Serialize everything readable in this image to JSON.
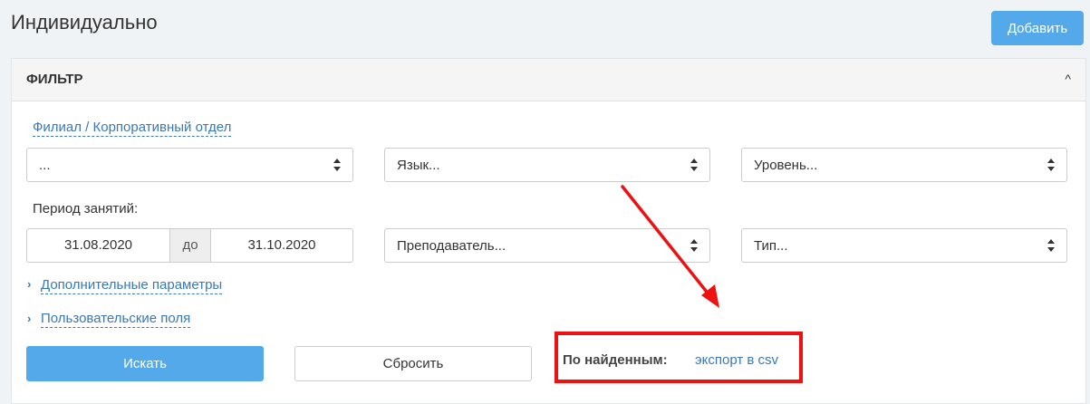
{
  "page": {
    "title": "Индивидуально"
  },
  "toolbar": {
    "add_label": "Добавить"
  },
  "filter": {
    "title": "ФИЛЬТР",
    "branch_link": "Филиал / Корпоративный отдел",
    "branch_select": "...",
    "language_select": "Язык...",
    "level_select": "Уровень...",
    "period_label": "Период занятий:",
    "date_from": "31.08.2020",
    "date_sep": "до",
    "date_to": "31.10.2020",
    "teacher_select": "Преподаватель...",
    "type_select": "Тип...",
    "extra_params_link": "Дополнительные параметры",
    "custom_fields_link": "Пользовательские поля",
    "search_label": "Искать",
    "reset_label": "Сбросить",
    "found_label": "По найденным:",
    "export_link": "экспорт в csv"
  },
  "colors": {
    "accent": "#53a9ea",
    "link": "#3a78b6",
    "annotation": "#ee1111"
  }
}
